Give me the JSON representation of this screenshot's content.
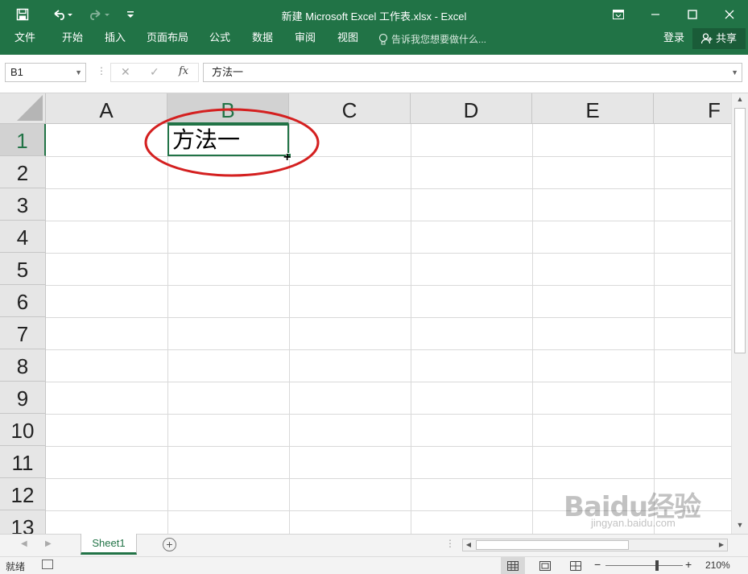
{
  "titlebar": {
    "title": "新建 Microsoft Excel 工作表.xlsx - Excel",
    "save_icon": "save-icon",
    "undo_icon": "undo-icon",
    "redo_icon": "redo-icon",
    "customize_icon": "customize-quick-access-icon"
  },
  "ribbon": {
    "tabs": [
      "文件",
      "开始",
      "插入",
      "页面布局",
      "公式",
      "数据",
      "审阅",
      "视图"
    ],
    "tell_me": "告诉我您想要做什么...",
    "login": "登录",
    "share": "共享"
  },
  "formula_bar": {
    "name_box": "B1",
    "formula": "方法一",
    "fx_label": "fx"
  },
  "grid": {
    "columns": [
      "A",
      "B",
      "C",
      "D",
      "E",
      "F"
    ],
    "rows": [
      "1",
      "2",
      "3",
      "4",
      "5",
      "6",
      "7",
      "8",
      "9",
      "10",
      "11",
      "12",
      "13"
    ],
    "selected_column": "B",
    "selected_row": "1",
    "cells": {
      "B1": "方法一"
    }
  },
  "sheets": {
    "tabs": [
      "Sheet1"
    ],
    "active": "Sheet1"
  },
  "status": {
    "ready": "就绪",
    "zoom": "210%"
  },
  "watermark": {
    "text": "Baidu经验",
    "url": "jingyan.baidu.com"
  },
  "colors": {
    "excel_green": "#217346",
    "annotation_red": "#d42020"
  }
}
